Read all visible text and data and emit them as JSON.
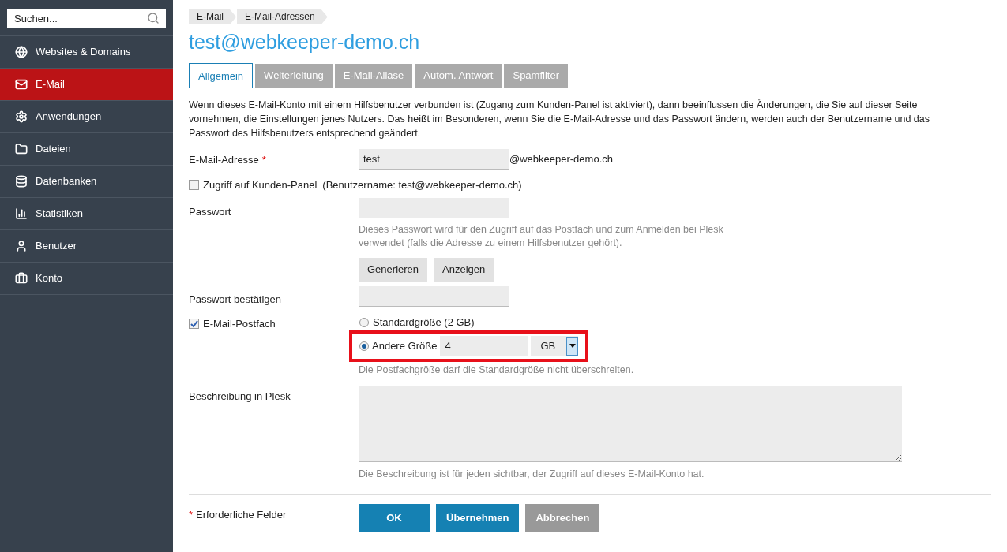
{
  "sidebar": {
    "search": {
      "placeholder": "Suchen..."
    },
    "items": [
      {
        "label": "Websites & Domains",
        "selected": false
      },
      {
        "label": "E-Mail",
        "selected": true
      },
      {
        "label": "Anwendungen",
        "selected": false
      },
      {
        "label": "Dateien",
        "selected": false
      },
      {
        "label": "Datenbanken",
        "selected": false
      },
      {
        "label": "Statistiken",
        "selected": false
      },
      {
        "label": "Benutzer",
        "selected": false
      },
      {
        "label": "Konto",
        "selected": false
      }
    ]
  },
  "breadcrumbs": [
    "E-Mail",
    "E-Mail-Adressen"
  ],
  "title": "test@webkeeper-demo.ch",
  "tabs": [
    {
      "label": "Allgemein",
      "selected": true
    },
    {
      "label": "Weiterleitung",
      "selected": false
    },
    {
      "label": "E-Mail-Aliase",
      "selected": false
    },
    {
      "label": "Autom. Antwort",
      "selected": false
    },
    {
      "label": "Spamfilter",
      "selected": false
    }
  ],
  "intro": "Wenn dieses E-Mail-Konto mit einem Hilfsbenutzer verbunden ist (Zugang zum Kunden-Panel ist aktiviert), dann beeinflussen die Änderungen, die Sie auf dieser Seite vornehmen, die Einstellungen jenes Nutzers. Das heißt im Besonderen, wenn Sie die E-Mail-Adresse und das Passwort ändern, werden auch der Benutzername und das Passwort des Hilfsbenutzers entsprechend geändert.",
  "form": {
    "email": {
      "label": "E-Mail-Adresse",
      "required_mark": "*",
      "value": "test",
      "suffix": "@webkeeper-demo.ch"
    },
    "panel_access": {
      "label": "Zugriff auf Kunden-Panel",
      "note": "(Benutzername: test@webkeeper-demo.ch)",
      "checked": false
    },
    "password": {
      "label": "Passwort",
      "hint": "Dieses Passwort wird für den Zugriff auf das Postfach und zum Anmelden bei Plesk verwendet (falls die Adresse zu einem Hilfsbenutzer gehört).",
      "buttons": [
        "Generieren",
        "Anzeigen"
      ]
    },
    "password_confirm": {
      "label": "Passwort bestätigen"
    },
    "mailbox": {
      "label": "E-Mail-Postfach",
      "checked": true,
      "options": [
        {
          "label": "Standardgröße (2 GB)",
          "selected": false
        },
        {
          "label": "Andere Größe",
          "selected": true,
          "value": "4",
          "unit": "GB"
        }
      ],
      "hint": "Die Postfachgröße darf die Standardgröße nicht überschreiten.",
      "highlighted": true
    },
    "description": {
      "label": "Beschreibung in Plesk",
      "hint": "Die Beschreibung ist für jeden sichtbar, der Zugriff auf dieses E-Mail-Konto hat."
    }
  },
  "footer": {
    "required_mark": "*",
    "required_note": "Erforderliche Felder",
    "buttons": [
      {
        "label": "OK",
        "kind": "primary"
      },
      {
        "label": "Übernehmen",
        "kind": "primary"
      },
      {
        "label": "Abbrechen",
        "kind": "secondary"
      }
    ]
  }
}
